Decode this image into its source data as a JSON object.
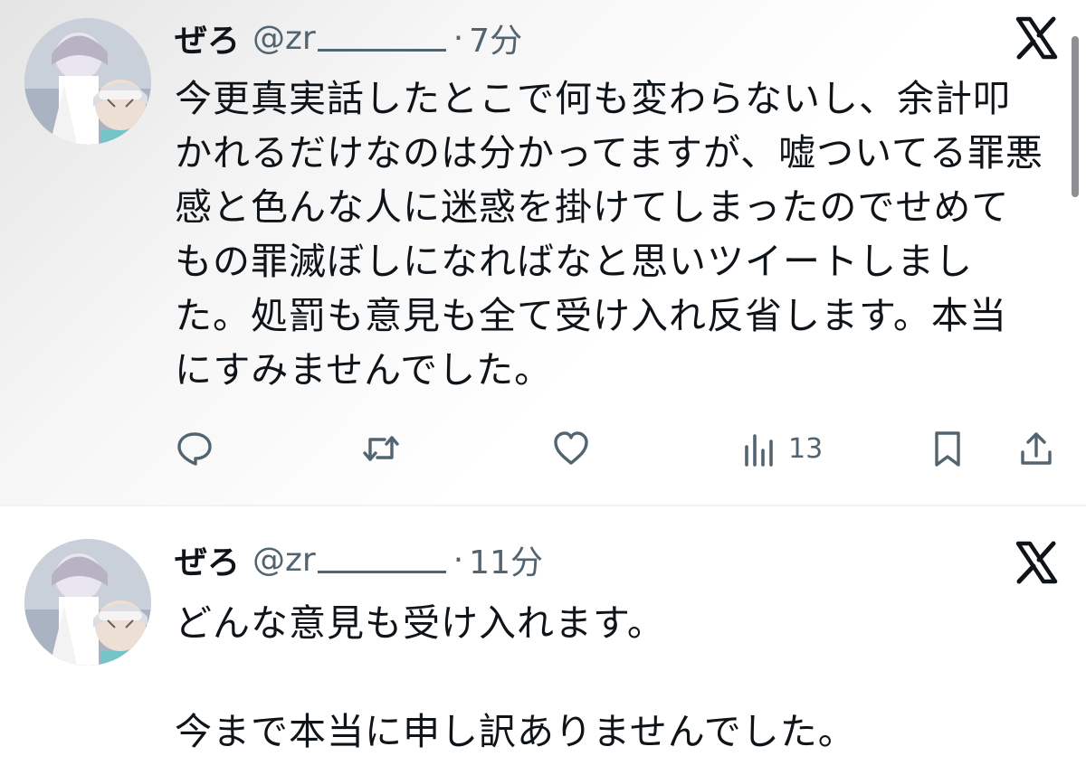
{
  "tweets": [
    {
      "author_name": "ぜろ",
      "handle": "@zr",
      "separator": "·",
      "time": "7分",
      "text": "今更真実話したとこで何も変わらないし、余計叩かれるだけなのは分かってますが、嘘ついてる罪悪感と色んな人に迷惑を掛けてしまったのでせめてもの罪滅ぼしになればなと思いツイートしました。処罰も意見も全て受け入れ反省します。本当にすみませんでした。",
      "views_count": "13",
      "icons": [
        "reply-icon",
        "retweet-icon",
        "like-icon",
        "views-icon",
        "bookmark-icon",
        "share-icon"
      ]
    },
    {
      "author_name": "ぜろ",
      "handle": "@zr",
      "separator": "·",
      "time": "11分",
      "text": "どんな意見も受け入れます。\n\n今まで本当に申し訳ありませんでした。"
    }
  ],
  "colors": {
    "text": "#0f1419",
    "secondary": "#536471",
    "divider": "#eff3f4"
  }
}
